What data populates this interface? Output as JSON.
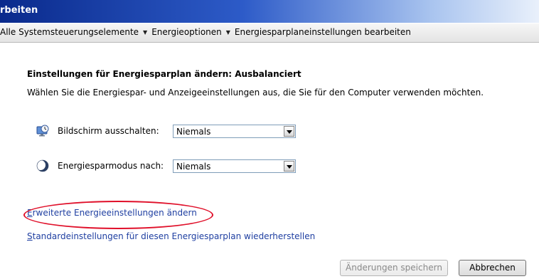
{
  "window": {
    "title": "rbeiten"
  },
  "breadcrumb": [
    "Alle Systemsteuerungselemente",
    "Energieoptionen",
    "Energiesparplaneinstellungen bearbeiten"
  ],
  "main": {
    "heading": "Einstellungen für Energiesparplan ändern: Ausbalanciert",
    "subtext": "Wählen Sie die Energiespar- und Anzeigeeinstellungen aus, die Sie für den Computer verwenden möchten.",
    "settings": [
      {
        "label": "Bildschirm ausschalten:",
        "value": "Niemals",
        "icon": "monitor-clock-icon"
      },
      {
        "label": "Energiesparmodus nach:",
        "value": "Niemals",
        "icon": "moon-icon"
      }
    ],
    "links": {
      "advanced_first": "E",
      "advanced_rest": "rweiterte Energieeinstellungen ändern",
      "restore_first": "S",
      "restore_rest": "tandardeinstellungen für diesen Energiesparplan wiederherstellen"
    }
  },
  "footer": {
    "save_label": "Änderungen speichern",
    "cancel_label": "Abbrechen"
  },
  "colors": {
    "link": "#1f3fa1",
    "highlight": "#e0102a"
  }
}
